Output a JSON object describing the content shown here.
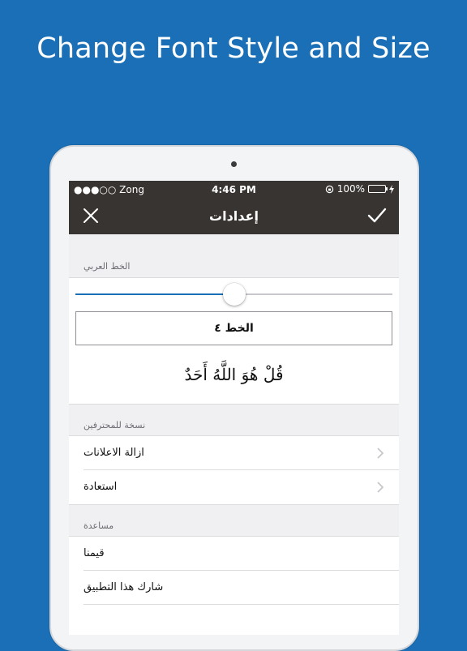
{
  "headline": "Change Font Style and Size",
  "status_bar": {
    "carrier": "●●●○○ Zong",
    "time": "4:46 PM",
    "battery": "100%"
  },
  "nav": {
    "title": "إعدادات",
    "close_icon": "close-icon",
    "check_icon": "checkmark-icon"
  },
  "sections": {
    "arabic_font": {
      "header": "الخط العربي",
      "slider_value": 0.5,
      "font_name": "الخط ٤",
      "preview": "قُلْ هُوَ اللَّهُ أَحَدٌ"
    },
    "pro": {
      "header": "نسخة للمحترفين",
      "items": [
        "ازالة الاعلانات",
        "استعادة"
      ]
    },
    "help": {
      "header": "مساعدة",
      "items": [
        "قيمنا",
        "شارك هذا التطبيق"
      ]
    }
  },
  "colors": {
    "background": "#1a6fb6",
    "bar": "#383431",
    "battery": "#4cd964"
  }
}
